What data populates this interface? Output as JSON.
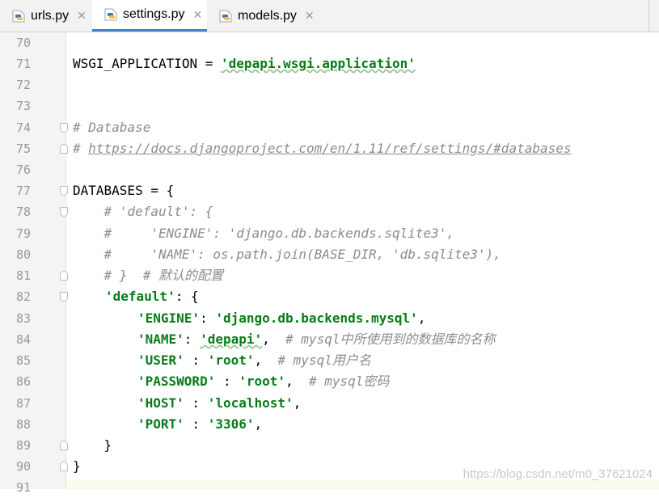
{
  "tabs": [
    {
      "label": "urls.py",
      "active": false
    },
    {
      "label": "settings.py",
      "active": true
    },
    {
      "label": "models.py",
      "active": false
    }
  ],
  "close_glyph": "✕",
  "line_numbers": [
    "70",
    "71",
    "72",
    "73",
    "74",
    "75",
    "76",
    "77",
    "78",
    "79",
    "80",
    "81",
    "82",
    "83",
    "84",
    "85",
    "86",
    "87",
    "88",
    "89",
    "90",
    "91"
  ],
  "code": {
    "l71_a": "WSGI_APPLICATION = ",
    "l71_str": "'depapi.wsgi.application'",
    "l74": "# Database",
    "l75_hash": "# ",
    "l75_link": "https://docs.djangoproject.com/en/1.11/ref/settings/#databases",
    "l77": "DATABASES = {",
    "l78": "    # 'default': {",
    "l79": "    #     'ENGINE': 'django.db.backends.sqlite3',",
    "l80": "    #     'NAME': os.path.join(BASE_DIR, 'db.sqlite3'),",
    "l81": "    # }  # 默认的配置",
    "l82_str": "'default'",
    "l82_rest": ": {",
    "l83_key": "'ENGINE'",
    "l83_sep": ": ",
    "l83_val": "'django.db.backends.mysql'",
    "l83_end": ",",
    "l84_key": "'NAME'",
    "l84_sep": ": ",
    "l84_val": "'depapi'",
    "l84_end": ",  ",
    "l84_cmt": "# mysql中所使用到的数据库的名称",
    "l85_key": "'USER'",
    "l85_sep": " : ",
    "l85_val": "'root'",
    "l85_end": ",  ",
    "l85_cmt": "# mysql用户名",
    "l86_key": "'PASSWORD'",
    "l86_sep": " : ",
    "l86_val": "'root'",
    "l86_end": ",  ",
    "l86_cmt": "# mysql密码",
    "l87_key": "'HOST'",
    "l87_sep": " : ",
    "l87_val": "'localhost'",
    "l87_end": ",",
    "l88_key": "'PORT'",
    "l88_sep": " : ",
    "l88_val": "'3306'",
    "l88_end": ",",
    "l89": "    }",
    "l90": "}"
  },
  "watermark": "https://blog.csdn.net/m0_37621024",
  "colors": {
    "string": "#067d17",
    "comment": "#8c8c8c",
    "tab_accent": "#4083c9"
  }
}
